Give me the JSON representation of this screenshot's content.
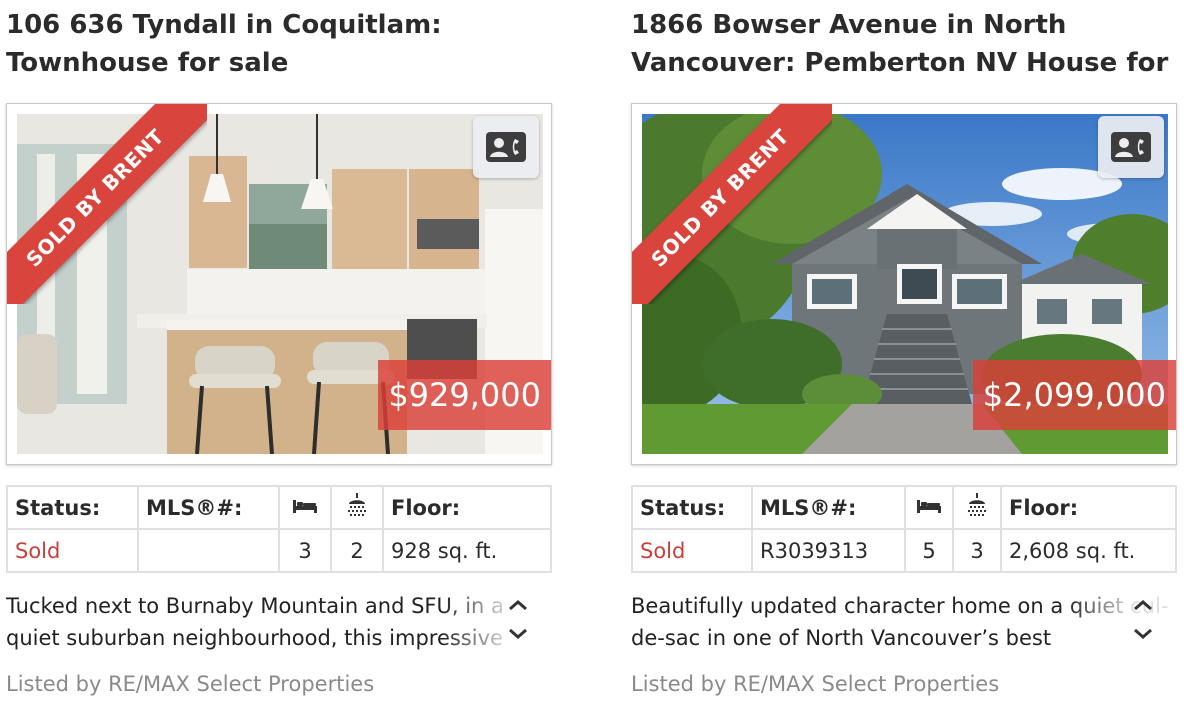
{
  "listings": [
    {
      "title": "106 636 Tyndall in Coquitlam: Townhouse for sale",
      "ribbon": "SOLD BY BRENT",
      "price": "$929,000",
      "contact_icon": "contact-card-icon",
      "table_headers": {
        "status": "Status:",
        "mls": "MLS®#:",
        "beds_icon": "bed-icon",
        "baths_icon": "shower-icon",
        "floor": "Floor:"
      },
      "status": "Sold",
      "mls": "",
      "beds": "3",
      "baths": "2",
      "floor": "928 sq. ft.",
      "description": "Tucked next to Burnaby Mountain and SFU, in a quiet suburban neighbourhood, this impressive",
      "listed_by": "Listed by RE/MAX Select Properties"
    },
    {
      "title": "1866 Bowser Avenue in North Vancouver: Pemberton NV House for",
      "ribbon": "SOLD BY BRENT",
      "price": "$2,099,000",
      "contact_icon": "contact-card-icon",
      "table_headers": {
        "status": "Status:",
        "mls": "MLS®#:",
        "beds_icon": "bed-icon",
        "baths_icon": "shower-icon",
        "floor": "Floor:"
      },
      "status": "Sold",
      "mls": "R3039313",
      "beds": "5",
      "baths": "3",
      "floor": "2,608 sq. ft.",
      "description": "Beautifully updated character home on a quiet cul-de-sac in one of North Vancouver’s best",
      "listed_by": "Listed by RE/MAX Select Properties"
    }
  ],
  "colors": {
    "accent_red": "#d9453d",
    "sold_text": "#c9403a",
    "muted_text": "#8a8a8a",
    "table_border": "#e0e0e0"
  },
  "icons": {
    "scroll_up": "chevron-up-icon",
    "scroll_down": "chevron-down-icon"
  }
}
